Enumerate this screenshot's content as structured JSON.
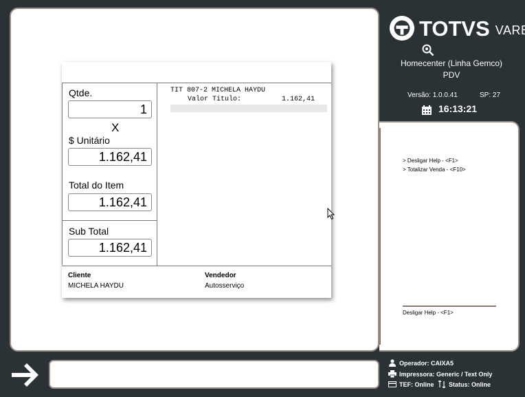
{
  "brand": {
    "logo_main": "TOTVS",
    "logo_sub": "VAREJO",
    "store_name": "Homecenter (Linha Gemco)",
    "store_sub": "PDV",
    "version": "Versão: 1.0.0.41",
    "sp": "SP: 27",
    "clock": "16:13:21"
  },
  "sale": {
    "qty_label": "Qtde.",
    "qty_value": "1",
    "times_sign": "X",
    "unit_label": "$ Unitário",
    "unit_value": "1.162,41",
    "item_total_label": "Total do Item",
    "item_total_value": "1.162,41",
    "subtotal_label": "Sub Total",
    "subtotal_value": "1.162,41",
    "receipt_line1": "TIT 807-2 MICHELA HAYDU",
    "receipt_line2_label": "Valor Titulo:",
    "receipt_line2_value": "1.162,41",
    "customer_label": "Cliente",
    "customer_value": "MICHELA HAYDU",
    "seller_label": "Vendedor",
    "seller_value": "Autosserviço"
  },
  "help": {
    "items": [
      "> Desligar Help - <F1>",
      "> Totalizar Venda - <F10>"
    ],
    "footer": "Desligar Help - <F1>"
  },
  "status": {
    "operator": "Operador: CAIXA5",
    "printer": "Impressora: Generic / Text Only",
    "tef": "TEF: Online",
    "status": "Status:  Online"
  },
  "command": {
    "value": ""
  },
  "icons": [
    "totvs-logo-icon",
    "search-icon",
    "calendar-icon",
    "mouse-cursor-icon",
    "arrow-right-icon",
    "user-icon",
    "printer-icon",
    "card-icon",
    "sync-icon"
  ]
}
